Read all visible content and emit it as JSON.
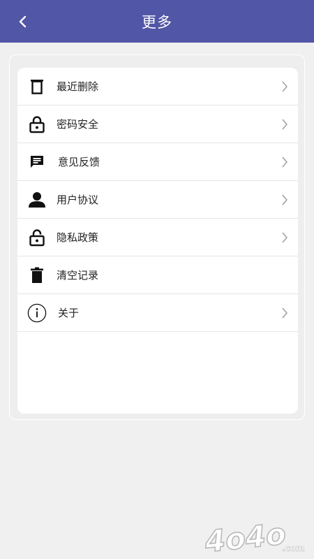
{
  "header": {
    "title": "更多",
    "background": "#5256a6"
  },
  "menu": [
    {
      "label": "最近删除",
      "icon": "trash-outline-icon",
      "has_arrow": true
    },
    {
      "label": "密码安全",
      "icon": "lock-icon",
      "has_arrow": true
    },
    {
      "label": "意见反馈",
      "icon": "message-icon",
      "has_arrow": true
    },
    {
      "label": "用户协议",
      "icon": "user-icon",
      "has_arrow": true
    },
    {
      "label": "隐私政策",
      "icon": "lock-open-icon",
      "has_arrow": true
    },
    {
      "label": "清空记录",
      "icon": "trash-filled-icon",
      "has_arrow": false
    },
    {
      "label": "关于",
      "icon": "info-icon",
      "has_arrow": true
    }
  ],
  "watermark": {
    "text": "4o4o",
    "suffix": ".com"
  }
}
